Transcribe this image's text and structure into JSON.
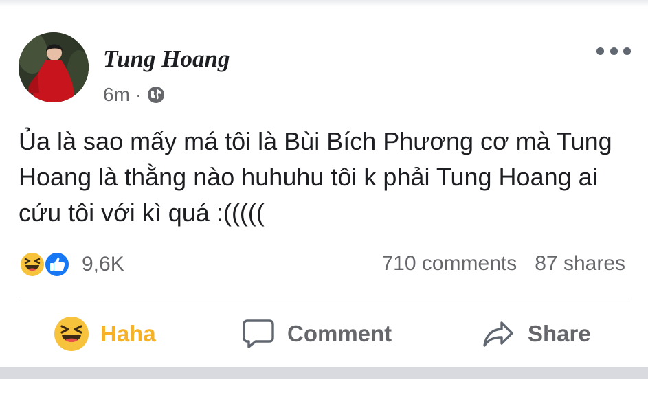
{
  "post": {
    "author": "Tung Hoang",
    "timestamp": "6m",
    "separator": "·",
    "privacy_icon": "globe-icon",
    "text": "Ủa là sao mấy má tôi là Bùi Bích Phương cơ mà Tung Hoang là thằng nào huhuhu tôi k phải Tung Hoang ai cứu tôi với kì quá :(((((",
    "reactions": {
      "icons": [
        "haha-icon",
        "like-icon"
      ],
      "count": "9,6K"
    },
    "comments": "710 comments",
    "shares": "87 shares"
  },
  "actions": {
    "haha_label": "Haha",
    "comment_label": "Comment",
    "share_label": "Share"
  },
  "colors": {
    "haha_active": "#f7b125",
    "secondary_text": "#65676b",
    "like_blue": "#1877f2"
  }
}
